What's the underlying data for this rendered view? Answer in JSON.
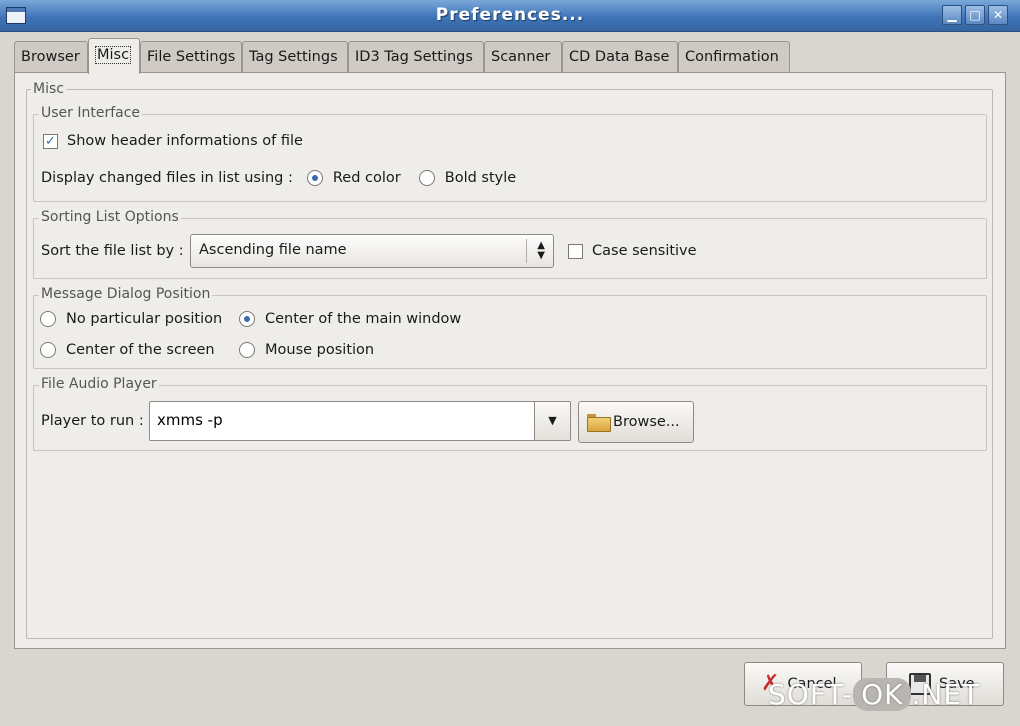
{
  "window": {
    "title": "Preferences...",
    "minimize_glyph": "▁",
    "maximize_glyph": "□",
    "close_glyph": "✕"
  },
  "tabs": [
    {
      "label": "Browser"
    },
    {
      "label": "Misc"
    },
    {
      "label": "File Settings"
    },
    {
      "label": "Tag Settings"
    },
    {
      "label": "ID3 Tag Settings"
    },
    {
      "label": "Scanner"
    },
    {
      "label": "CD Data Base"
    },
    {
      "label": "Confirmation"
    }
  ],
  "active_tab": "Misc",
  "misc": {
    "frame_label": "Misc",
    "user_interface": {
      "label": "User Interface",
      "show_header_label": "Show header informations of file",
      "show_header_checked": true,
      "display_changed_label": "Display changed files in list using :",
      "red_color_label": "Red color",
      "bold_style_label": "Bold style",
      "selected": "Red color"
    },
    "sorting": {
      "label": "Sorting List Options",
      "sort_by_label": "Sort the file list by :",
      "sort_value": "Ascending file name",
      "case_sensitive_label": "Case sensitive",
      "case_sensitive_checked": false
    },
    "message_dialog": {
      "label": "Message Dialog Position",
      "no_particular": "No particular position",
      "center_main": "Center of the main window",
      "center_screen": "Center of the screen",
      "mouse_position": "Mouse position",
      "selected": "Center of the main window"
    },
    "audio_player": {
      "label": "File Audio Player",
      "player_label": "Player to run :",
      "player_value": "xmms -p",
      "browse_label": "Browse..."
    }
  },
  "footer": {
    "cancel_label": "Cancel",
    "save_label": "Save"
  },
  "watermark": {
    "part1": "SOFT-",
    "part2": "OK",
    "part3": ".NET"
  },
  "icons": {
    "checkbox_checked": "✓",
    "combo_up": "▲",
    "combo_down": "▼",
    "dropdown": "▼",
    "cancel": "✗"
  },
  "colors": {
    "titlebar": "#3f74b8",
    "accent": "#3a6db0",
    "cancel_icon": "#c0302b"
  }
}
